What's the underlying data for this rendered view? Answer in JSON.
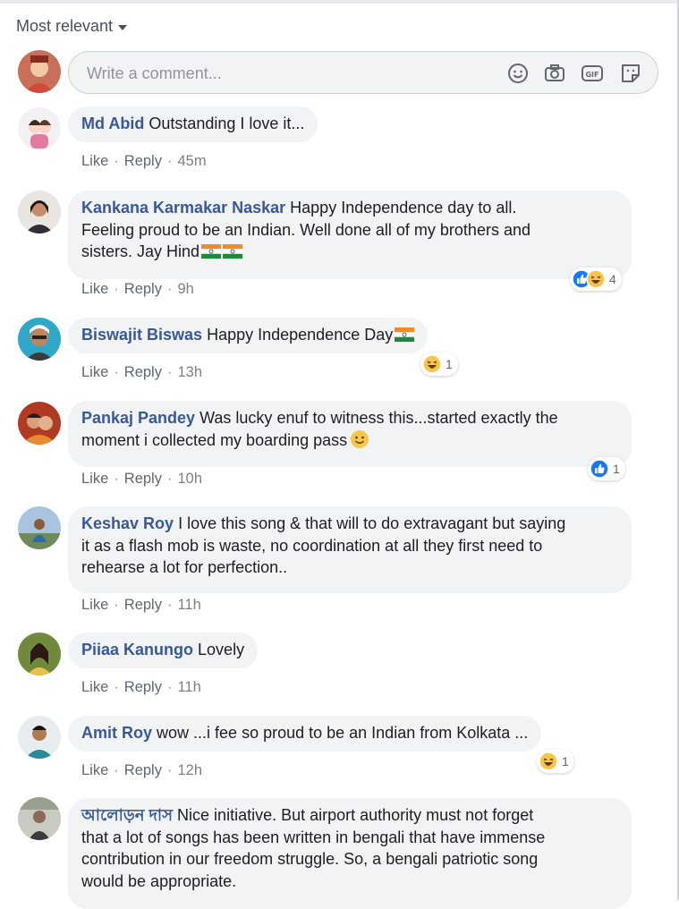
{
  "sort_label": "Most relevant",
  "composer": {
    "placeholder": "Write a comment..."
  },
  "action_labels": {
    "like": "Like",
    "reply": "Reply"
  },
  "comments": [
    {
      "author": "Md Abid",
      "text": "Outstanding I love it...",
      "time": "45m",
      "reactions": null
    },
    {
      "author": "Kankana Karmakar Naskar",
      "text_lines": [
        "Happy Independence day to all.",
        "Feeling proud to be an Indian. Well done all of my brothers and",
        "sisters. Jay Hind"
      ],
      "time": "9h",
      "reactions": {
        "icons": [
          "like-icon",
          "haha-icon"
        ],
        "count": "4"
      }
    },
    {
      "author": "Biswajit Biswas",
      "text": "Happy Independence Day",
      "time": "13h",
      "reactions": {
        "icons": [
          "haha-icon"
        ],
        "count": "1"
      }
    },
    {
      "author": "Pankaj Pandey",
      "text_lines": [
        "Was lucky enuf to witness this...started exactly the",
        "moment i collected my boarding pass"
      ],
      "time": "10h",
      "reactions": {
        "icons": [
          "like-icon"
        ],
        "count": "1"
      }
    },
    {
      "author": "Keshav Roy",
      "text_lines": [
        "I love this song & that will to do extravagant but saying",
        "it as a flash mob is waste, no coordination at all they first need to",
        "rehearse a lot for perfection.."
      ],
      "time": "11h",
      "reactions": null
    },
    {
      "author": "Piiaa Kanungo",
      "text": "Lovely",
      "time": "11h",
      "reactions": null
    },
    {
      "author": "Amit Roy",
      "text": "wow ...i fee so proud to be an Indian from Kolkata ...",
      "time": "12h",
      "reactions": {
        "icons": [
          "haha-icon"
        ],
        "count": "1"
      }
    },
    {
      "author": "আলোড়ন দাস",
      "text_lines": [
        "Nice initiative. But airport authority must not forget",
        "that a lot of songs has been written in bengali that have immense",
        "contribution in our freedom struggle. So, a bengali patriotic song",
        "would be appropriate."
      ],
      "time": "",
      "reactions": null
    }
  ],
  "colors": {
    "author": "#385898",
    "bubble": "#f2f3f5",
    "like_blue": "#1877f2",
    "haha_yellow": "#f7c64a"
  }
}
